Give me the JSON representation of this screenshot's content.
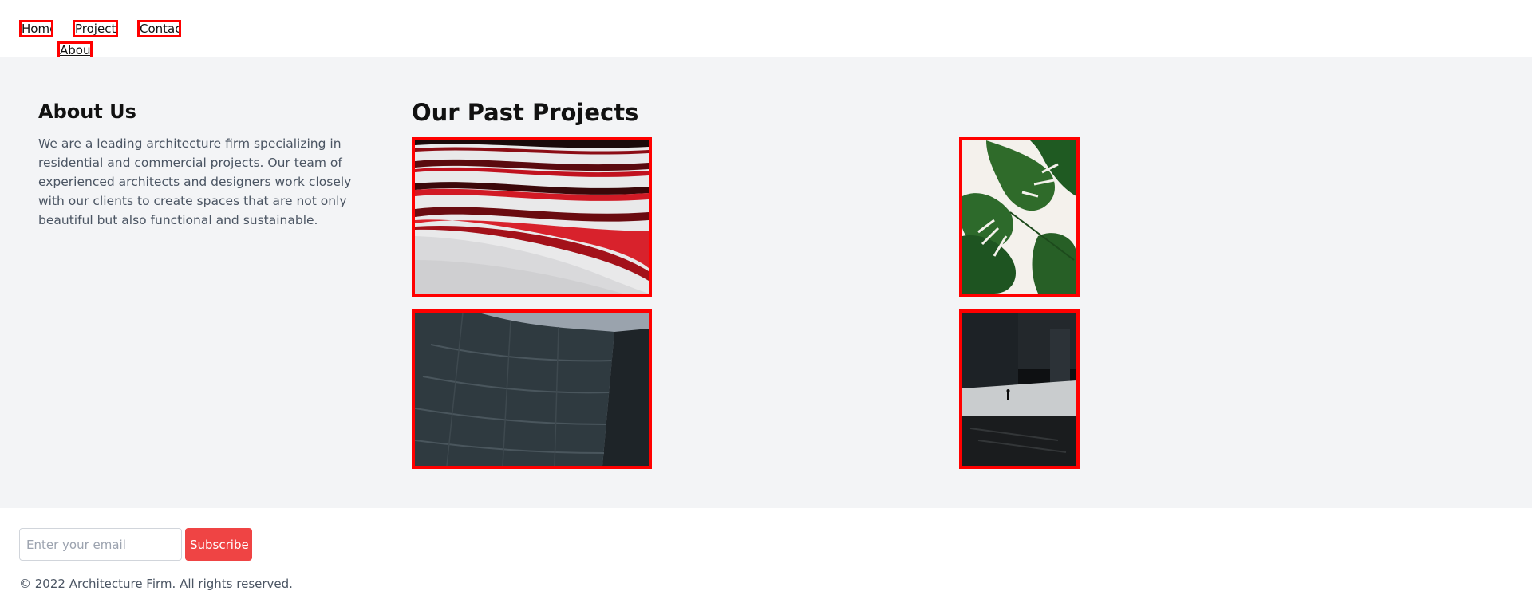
{
  "nav": {
    "items": [
      {
        "label": "Home"
      },
      {
        "label": "About"
      },
      {
        "label": "Projects"
      },
      {
        "label": "Contact"
      }
    ]
  },
  "about": {
    "title": "About Us",
    "text": "We are a leading architecture firm specializing in residential and commercial projects. Our team of experienced architects and designers work closely with our clients to create spaces that are not only beautiful but also functional and sustainable."
  },
  "projects": {
    "title": "Our Past Projects",
    "items": [
      {
        "image": "red-white-curved-facade"
      },
      {
        "image": "monstera-leaves"
      },
      {
        "image": "curved-glass-skyscraper"
      },
      {
        "image": "dark-city-plaza"
      }
    ]
  },
  "footer": {
    "email_placeholder": "Enter your email",
    "subscribe_label": "Subscribe",
    "copyright": "© 2022 Architecture Firm. All rights reserved."
  },
  "colors": {
    "accent": "#ef4444",
    "frame": "#ff0000",
    "main_bg": "#f3f4f6",
    "body_text": "#4b5563"
  }
}
